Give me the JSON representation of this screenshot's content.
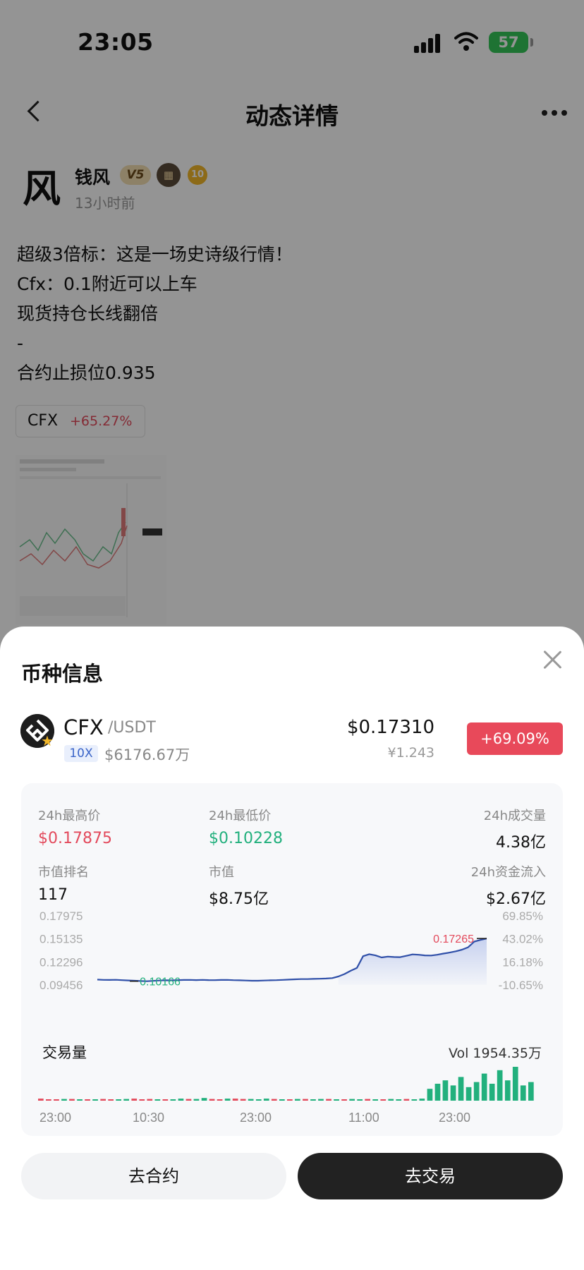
{
  "status_bar": {
    "time": "23:05",
    "battery": "57"
  },
  "nav": {
    "title": "动态详情"
  },
  "author": {
    "avatar_text": "风",
    "name": "钱风",
    "vip": "V5",
    "level": "10",
    "time": "13小时前"
  },
  "post": {
    "lines": [
      "超级3倍标：这是一场史诗级行情！",
      "Cfx：0.1附近可以上车",
      "现货持仓长线翻倍",
      "-",
      "合约止损位0.935"
    ],
    "tag": {
      "symbol": "CFX",
      "change": "+65.27%"
    }
  },
  "sheet": {
    "title": "币种信息",
    "coin": {
      "symbol": "CFX",
      "pair": "/USDT",
      "leverage": "10X",
      "market_cap": "$6176.67万",
      "price_usd": "$0.17310",
      "price_cny": "¥1.243",
      "change": "+69.09%"
    },
    "stats": [
      {
        "label": "24h最高价",
        "value": "$0.17875",
        "tone": "red"
      },
      {
        "label": "24h最低价",
        "value": "$0.10228",
        "tone": "green"
      },
      {
        "label": "24h成交量",
        "value": "4.38亿",
        "tone": "default"
      },
      {
        "label": "市值排名",
        "value": "117",
        "tone": "default"
      },
      {
        "label": "市值",
        "value": "$8.75亿",
        "tone": "default"
      },
      {
        "label": "24h资金流入",
        "value": "$2.67亿",
        "tone": "default"
      }
    ],
    "volume": {
      "title": "交易量",
      "total": "Vol 1954.35万"
    },
    "buttons": {
      "contract": "去合约",
      "trade": "去交易"
    }
  },
  "colors": {
    "up": "#e34a5c",
    "down": "#22b07d",
    "line": "#2f4fa8",
    "dark_button": "#222222"
  },
  "chart_data": {
    "type": "line",
    "y_ticks_left": [
      "0.17975",
      "0.15135",
      "0.12296",
      "0.09456"
    ],
    "y_ticks_right": [
      "69.85%",
      "43.02%",
      "16.18%",
      "-10.65%"
    ],
    "x_ticks": [
      "23:00",
      "10:30",
      "23:00",
      "11:00",
      "23:00"
    ],
    "ylim": [
      0.09456,
      0.17975
    ],
    "annotations": {
      "high": "0.17265",
      "low": "0.10166"
    },
    "values": [
      0.1012,
      0.1008,
      0.1007,
      0.1009,
      0.1005,
      0.1001,
      0.0998,
      0.0994,
      0.0992,
      0.0996,
      0.1,
      0.1003,
      0.1002,
      0.1005,
      0.1007,
      0.1008,
      0.1006,
      0.1008,
      0.1006,
      0.1005,
      0.1007,
      0.1008,
      0.1005,
      0.1003,
      0.1,
      0.0998,
      0.0998,
      0.1,
      0.1003,
      0.1005,
      0.1008,
      0.1012,
      0.1015,
      0.1018,
      0.1018,
      0.102,
      0.1022,
      0.1025,
      0.103,
      0.105,
      0.108,
      0.112,
      0.1155,
      0.13,
      0.1325,
      0.131,
      0.1285,
      0.1295,
      0.129,
      0.1288,
      0.1305,
      0.1322,
      0.1318,
      0.131,
      0.1308,
      0.1318,
      0.1332,
      0.1345,
      0.136,
      0.138,
      0.141,
      0.148,
      0.15,
      0.1518
    ],
    "volume_series": [
      {
        "name": "up",
        "values": [
          0.04,
          0.02,
          0.03,
          0.05,
          0.02,
          0.03,
          0.02,
          0.04,
          0.03,
          0.02,
          0.03,
          0.05,
          0.04,
          0.02,
          0.03,
          0.04,
          0.02,
          0.03,
          0.06,
          0.04,
          0.05,
          0.08,
          0.04,
          0.03,
          0.06,
          0.04,
          0.03,
          0.05,
          0.04,
          0.06,
          0.03,
          0.04,
          0.02,
          0.05,
          0.03,
          0.04,
          0.05,
          0.03,
          0.04,
          0.03,
          0.05,
          0.04,
          0.03,
          0.04,
          0.03,
          0.05,
          0.04,
          0.03,
          0.04,
          0.06,
          0.35,
          0.5,
          0.6,
          0.45,
          0.7,
          0.4,
          0.55,
          0.8,
          0.5,
          0.9,
          0.6,
          1.0,
          0.45,
          0.55
        ]
      },
      {
        "name": "down",
        "values": [
          0.06,
          0.03,
          0.04,
          0.02,
          0.05,
          0.02,
          0.04,
          0.03,
          0.05,
          0.04,
          0.02,
          0.03,
          0.06,
          0.04,
          0.05,
          0.03,
          0.04,
          0.02,
          0.03,
          0.05,
          0.04,
          0.03,
          0.05,
          0.04,
          0.02,
          0.06,
          0.05,
          0.03,
          0.04,
          0.03,
          0.05,
          0.03,
          0.04,
          0.03,
          0.05,
          0.04,
          0.03,
          0.05,
          0.02,
          0.04,
          0.03,
          0.02,
          0.05,
          0.03,
          0.04,
          0.02,
          0.03,
          0.05,
          0.02,
          0.04,
          0.05,
          0.15,
          0.1,
          0.3,
          0.2,
          0.35,
          0.25,
          0.2,
          0.3,
          0.15,
          0.4,
          0.2,
          0.3,
          0.25
        ]
      }
    ]
  }
}
